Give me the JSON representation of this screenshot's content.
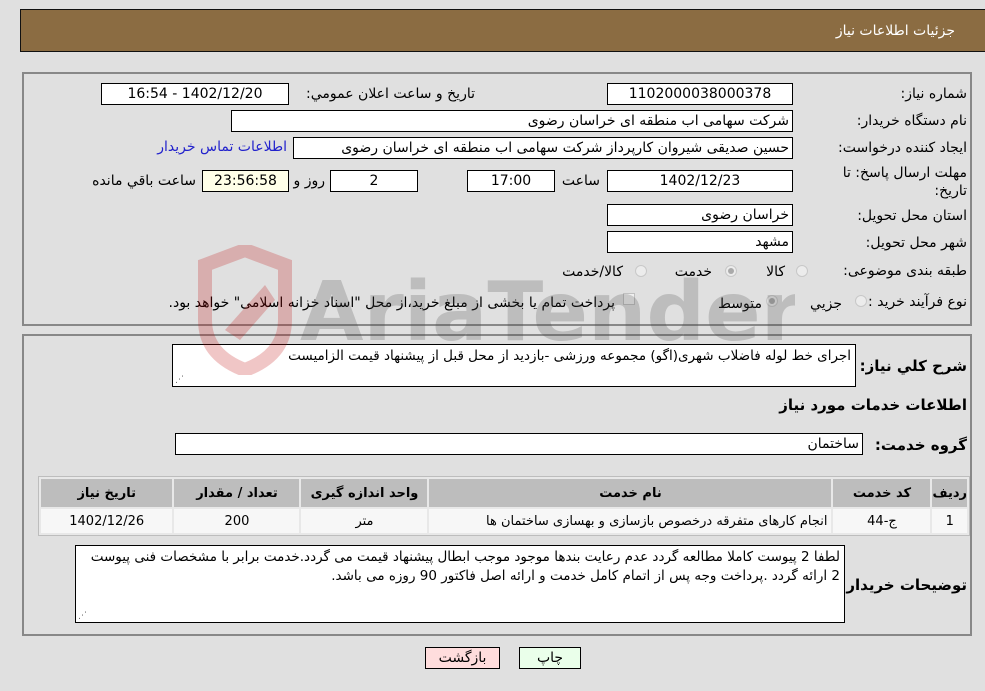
{
  "header": {
    "title": "جزئیات اطلاعات نیاز"
  },
  "details": {
    "need_number_label": "شماره نیاز:",
    "need_number": "1102000038000378",
    "announce_label": "تاریخ و ساعت اعلان عمومي:",
    "announce_value": "1402/12/20 - 16:54",
    "buyer_org_label": "نام دستگاه خریدار:",
    "buyer_org": "شرکت سهامی اب منطقه ای خراسان رضوی",
    "requester_label": "ایجاد کننده درخواست:",
    "requester": "حسین صدیقی شیروان کارپرداز شرکت سهامی اب منطقه ای خراسان رضوی",
    "contact_link": "اطلاعات تماس خریدار",
    "deadline_label": "مهلت ارسال پاسخ: تا تاریخ:",
    "deadline_date": "1402/12/23",
    "time_label": "ساعت",
    "deadline_time": "17:00",
    "days_value": "2",
    "days_label": "روز و",
    "remaining_time": "23:56:58",
    "remaining_label": "ساعت باقي مانده",
    "province_label": "استان محل تحویل:",
    "province": "خراسان رضوی",
    "city_label": "شهر محل تحویل:",
    "city": "مشهد",
    "category_label": "طبقه بندی موضوعی:",
    "category_options": [
      "کالا",
      "خدمت",
      "کالا/خدمت"
    ],
    "category_selected": "خدمت",
    "process_label": "نوع فرآیند خرید :",
    "process_options": [
      "جزيي",
      "متوسط"
    ],
    "process_selected": "متوسط",
    "treasury_note": "پرداخت تمام یا بخشی از مبلغ خرید،از محل \"اسناد خزانه اسلامی\" خواهد بود."
  },
  "description": {
    "label": "شرح كلي نياز:",
    "text": "اجرای خط لوله فاضلاب شهری(اگو) مجموعه ورزشی -بازدید از محل قبل از پیشنهاد قیمت الزامیست"
  },
  "services": {
    "section_title": "اطلاعات خدمات مورد نياز",
    "group_label": "گروه خدمت:",
    "group_value": "ساختمان",
    "columns": [
      "رديف",
      "کد خدمت",
      "نام خدمت",
      "واحد اندازه گیری",
      "تعداد / مقدار",
      "تاریخ نیاز"
    ],
    "rows": [
      {
        "row": "1",
        "code": "ج-44",
        "name": "انجام کارهای متفرقه درخصوص بازسازی و بهسازی ساختمان ها",
        "unit": "متر",
        "qty": "200",
        "date": "1402/12/26"
      }
    ]
  },
  "buyer_notes": {
    "label": "توضیحات خریدار:",
    "text": "لطفا 2 پیوست کاملا مطالعه گردد عدم رعایت بندها موجود موجب ابطال پیشنهاد قیمت می گردد.خدمت برابر با مشخصات فنی پیوست 2 ارائه گردد .پرداخت وجه پس از اتمام کامل خدمت و ارائه اصل فاکتور 90 روزه می باشد."
  },
  "buttons": {
    "print": "چاپ",
    "back": "بازگشت"
  },
  "colors": {
    "header_bg": "#8b6c42",
    "print_bg": "#eaffea",
    "back_bg": "#ffdddd",
    "link": "#2222cc"
  },
  "watermark": {
    "text": "AriaTender.neT"
  }
}
